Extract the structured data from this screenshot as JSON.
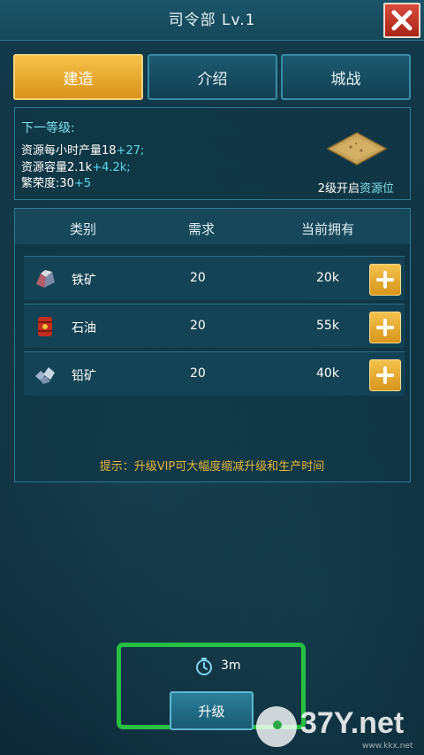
{
  "header": {
    "title": "司令部 Lv.1"
  },
  "tabs": [
    {
      "label": "建造",
      "active": true
    },
    {
      "label": "介绍",
      "active": false
    },
    {
      "label": "城战",
      "active": false
    }
  ],
  "next_level": {
    "heading": "下一等级:",
    "line1_text": "资源每小时产量18",
    "line1_plus": "+27;",
    "line2_text": "资源容量2.1k",
    "line2_plus": "+4.2k;",
    "line3_text": "繁荣度:30",
    "line3_plus": "+5",
    "unlock_prefix": "2级开启",
    "unlock_highlight": "资源位"
  },
  "requirements": {
    "headers": {
      "category": "类别",
      "required": "需求",
      "owned": "当前拥有"
    },
    "rows": [
      {
        "name": "铁矿",
        "required": "20",
        "owned": "20k",
        "icon": "iron-ore-icon"
      },
      {
        "name": "石油",
        "required": "20",
        "owned": "55k",
        "icon": "oil-barrel-icon"
      },
      {
        "name": "铅矿",
        "required": "20",
        "owned": "40k",
        "icon": "lead-ore-icon"
      }
    ]
  },
  "tip": "提示：升级VIP可大幅度缩减升级和生产时间",
  "upgrade": {
    "time": "3m",
    "button_label": "升级"
  },
  "watermark": {
    "text": "37Y.net",
    "sub": "www.kkx.net"
  },
  "colors": {
    "accent_gold": "#f4c24e",
    "highlight_cyan": "#5fd8ec",
    "tip_yellow": "#e7b53a",
    "frame_green": "#27c042"
  }
}
